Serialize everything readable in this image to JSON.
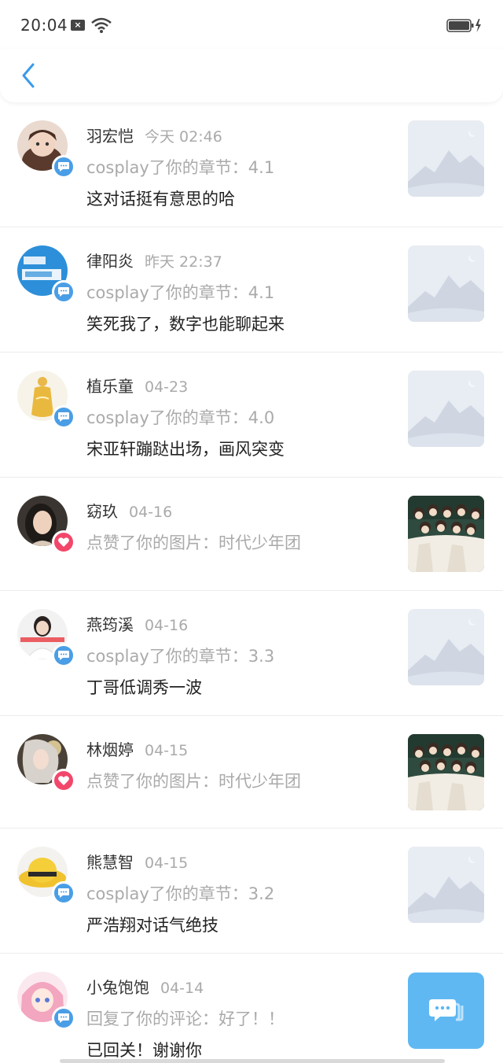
{
  "status_bar": {
    "time": "20:04",
    "sim_icon": "sim-off-icon",
    "wifi_icon": "wifi-icon",
    "battery_icon": "battery-charging-icon"
  },
  "nav": {
    "back_icon": "chevron-left-icon"
  },
  "colors": {
    "accent": "#4a9ee6",
    "like": "#f2476a",
    "fab": "#5fb8f2"
  },
  "notifications": [
    {
      "name": "羽宏恺",
      "date": "今天 02:46",
      "action": "cosplay了你的章节：4.1",
      "text": "这对话挺有意思的哈",
      "badge": "comment",
      "thumb": "placeholder"
    },
    {
      "name": "律阳炎",
      "date": "昨天 22:37",
      "action": "cosplay了你的章节：4.1",
      "text": "笑死我了，数字也能聊起来",
      "badge": "comment",
      "thumb": "placeholder"
    },
    {
      "name": "植乐童",
      "date": "04-23",
      "action": "cosplay了你的章节：4.0",
      "text": "宋亚轩蹦跶出场，画风突变",
      "badge": "comment",
      "thumb": "placeholder"
    },
    {
      "name": "窈玖",
      "date": "04-16",
      "action": "点赞了你的图片：时代少年团",
      "text": "",
      "badge": "like",
      "thumb": "photo"
    },
    {
      "name": "燕筠溪",
      "date": "04-16",
      "action": "cosplay了你的章节：3.3",
      "text": "丁哥低调秀一波",
      "badge": "comment",
      "thumb": "placeholder"
    },
    {
      "name": "林烟婷",
      "date": "04-15",
      "action": "点赞了你的图片：时代少年团",
      "text": "",
      "badge": "like",
      "thumb": "photo"
    },
    {
      "name": "熊慧智",
      "date": "04-15",
      "action": "cosplay了你的章节：3.2",
      "text": "严浩翔对话气绝技",
      "badge": "comment",
      "thumb": "placeholder"
    },
    {
      "name": "小兔饱饱",
      "date": "04-14",
      "action": "回复了你的评论：好了！！",
      "text": "已回关！谢谢你",
      "badge": "comment",
      "thumb": "none"
    }
  ],
  "fab": {
    "icon": "chat-bubble-icon"
  }
}
